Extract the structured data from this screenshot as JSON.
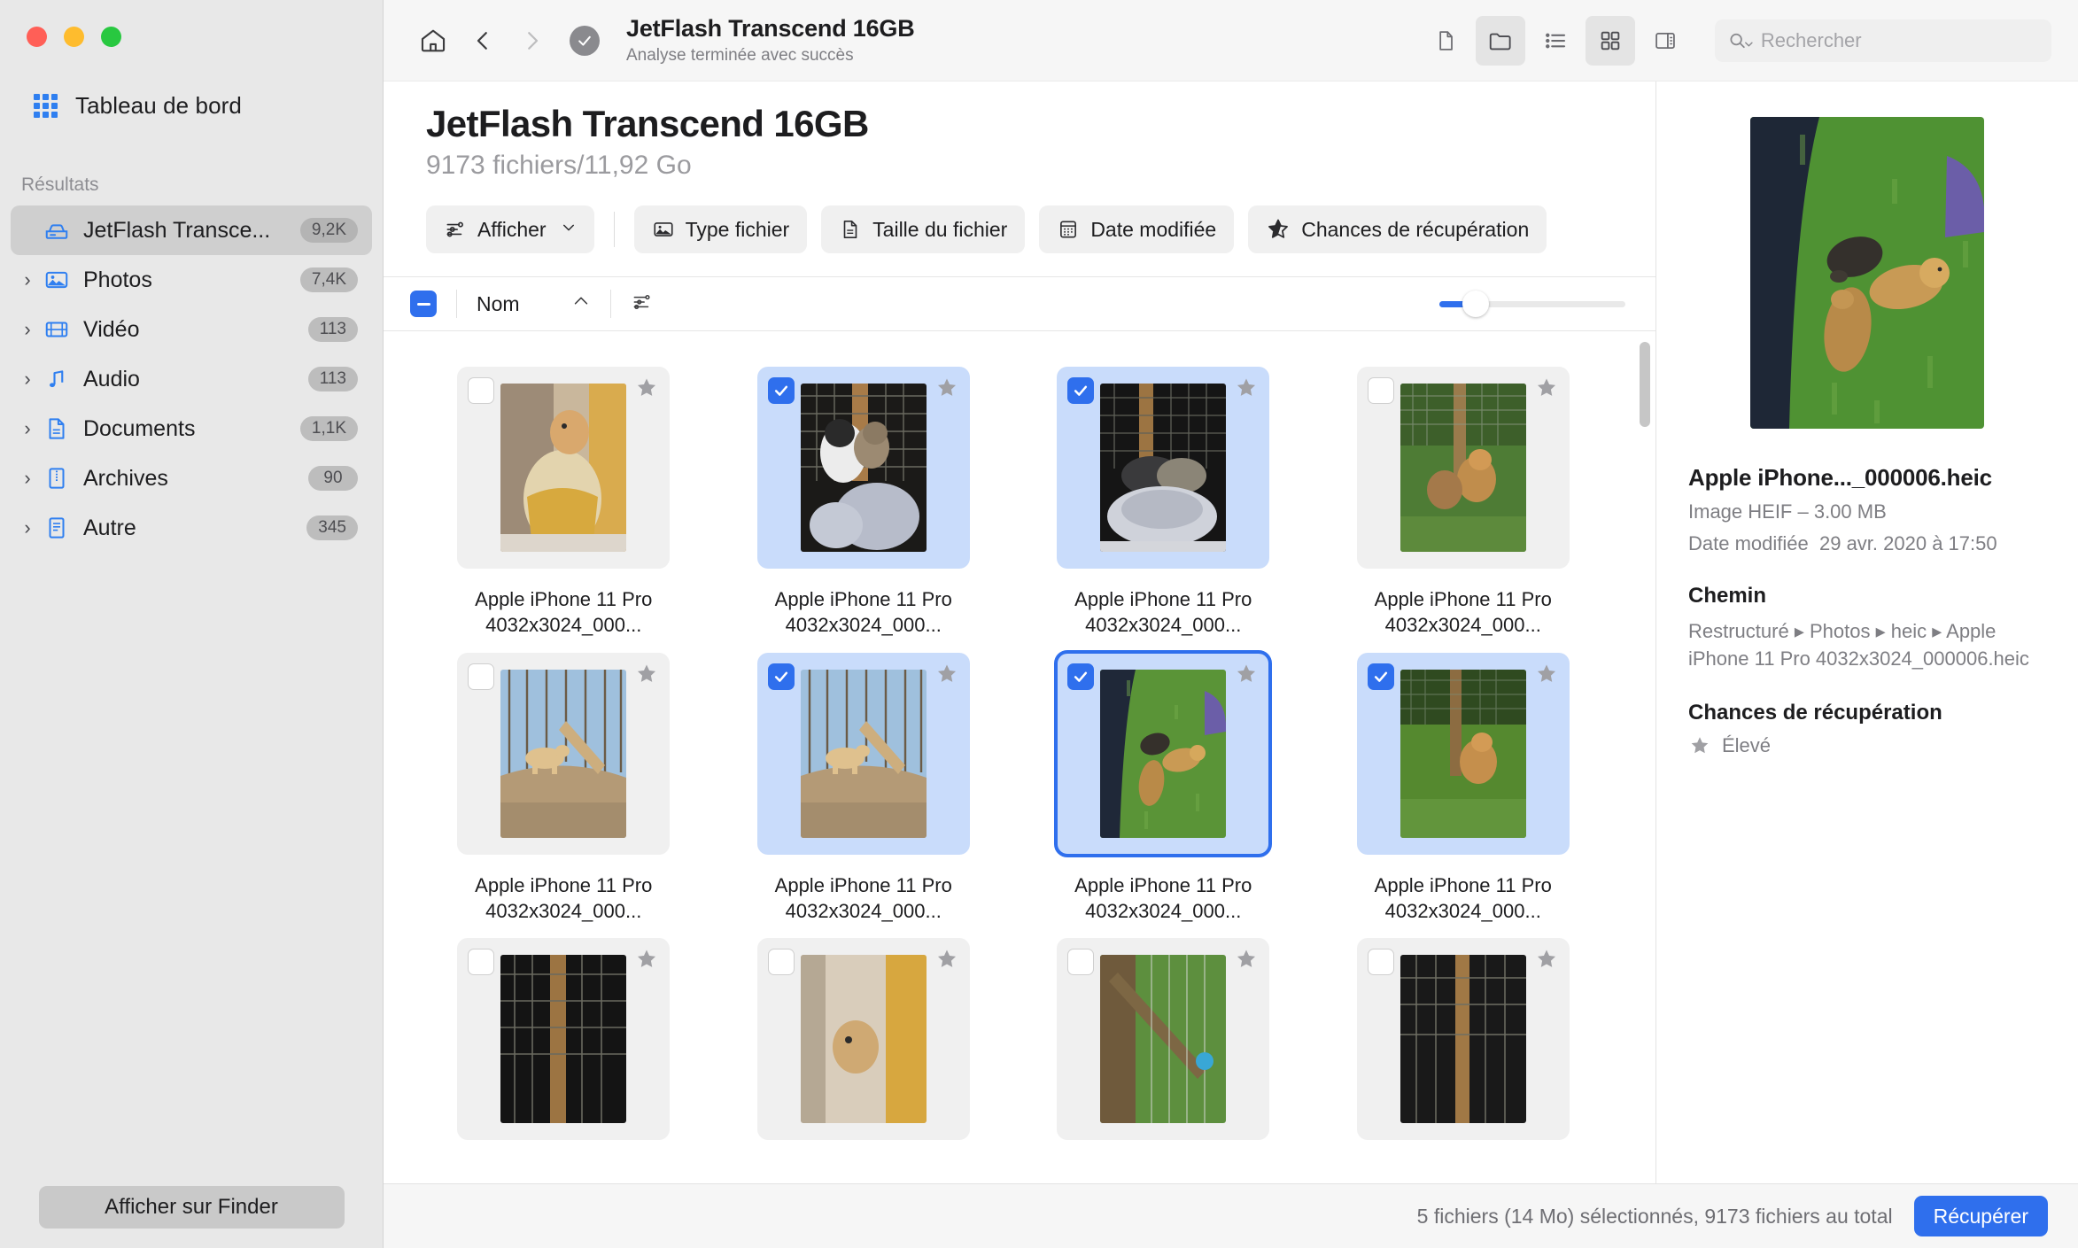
{
  "window": {
    "traffic_lights": [
      "close",
      "minimize",
      "zoom"
    ]
  },
  "sidebar": {
    "dashboard_label": "Tableau de bord",
    "section_title": "Résultats",
    "items": [
      {
        "label": "JetFlash Transce...",
        "badge": "9,2K",
        "icon": "drive-icon",
        "expandable": false,
        "selected": true
      },
      {
        "label": "Photos",
        "badge": "7,4K",
        "icon": "photo-icon",
        "expandable": true,
        "selected": false
      },
      {
        "label": "Vidéo",
        "badge": "113",
        "icon": "video-icon",
        "expandable": true,
        "selected": false
      },
      {
        "label": "Audio",
        "badge": "113",
        "icon": "audio-icon",
        "expandable": true,
        "selected": false
      },
      {
        "label": "Documents",
        "badge": "1,1K",
        "icon": "document-icon",
        "expandable": true,
        "selected": false
      },
      {
        "label": "Archives",
        "badge": "90",
        "icon": "archive-icon",
        "expandable": true,
        "selected": false
      },
      {
        "label": "Autre",
        "badge": "345",
        "icon": "other-icon",
        "expandable": true,
        "selected": false
      }
    ],
    "finder_button": "Afficher sur Finder"
  },
  "toolbar": {
    "home_icon": "home-icon",
    "back_icon": "chevron-left-icon",
    "forward_icon": "chevron-right-icon",
    "status_icon": "checkmark-circle-icon",
    "title": "JetFlash Transcend 16GB",
    "subtitle": "Analyse terminée avec succès",
    "view_buttons": [
      {
        "name": "file-view-icon",
        "active": false
      },
      {
        "name": "folder-view-icon",
        "active": true
      },
      {
        "name": "list-view-icon",
        "active": false
      },
      {
        "name": "grid-view-icon",
        "active": true
      },
      {
        "name": "sidebar-view-icon",
        "active": false
      }
    ],
    "search_placeholder": "Rechercher",
    "search_value": ""
  },
  "page": {
    "title": "JetFlash Transcend 16GB",
    "subtitle": "9173 fichiers/11,92 Go"
  },
  "filters": {
    "show": {
      "label": "Afficher",
      "icon": "sliders-icon",
      "caret": "chevron-down-icon"
    },
    "chips": [
      {
        "label": "Type fichier",
        "icon": "image-icon"
      },
      {
        "label": "Taille du fichier",
        "icon": "document-icon"
      },
      {
        "label": "Date modifiée",
        "icon": "calendar-icon"
      },
      {
        "label": "Chances de récupération",
        "icon": "star-outline-icon"
      }
    ]
  },
  "grid_header": {
    "select_all_state": "partial",
    "sort_column": "Nom",
    "sort_direction_icon": "chevron-up-icon",
    "options_icon": "sliders-icon",
    "zoom_slider_value": 14
  },
  "grid": {
    "items": [
      {
        "caption": "Apple iPhone 11 Pro 4032x3024_000...",
        "checked": false,
        "active": false,
        "starred": true,
        "thumb": "cat-in-basket"
      },
      {
        "caption": "Apple iPhone 11 Pro 4032x3024_000...",
        "checked": true,
        "active": false,
        "starred": true,
        "thumb": "two-cats"
      },
      {
        "caption": "Apple iPhone 11 Pro 4032x3024_000...",
        "checked": true,
        "active": false,
        "starred": true,
        "thumb": "cats-in-bed"
      },
      {
        "caption": "Apple iPhone 11 Pro 4032x3024_000...",
        "checked": false,
        "active": false,
        "starred": true,
        "thumb": "chickens-coop"
      },
      {
        "caption": "Apple iPhone 11 Pro 4032x3024_000...",
        "checked": false,
        "active": false,
        "starred": true,
        "thumb": "dog-on-log"
      },
      {
        "caption": "Apple iPhone 11 Pro 4032x3024_000...",
        "checked": true,
        "active": false,
        "starred": true,
        "thumb": "dog-on-log"
      },
      {
        "caption": "Apple iPhone 11 Pro 4032x3024_000...",
        "checked": true,
        "active": true,
        "starred": true,
        "thumb": "chicks-grass"
      },
      {
        "caption": "Apple iPhone 11 Pro 4032x3024_000...",
        "checked": true,
        "active": false,
        "starred": true,
        "thumb": "chicken-green"
      },
      {
        "caption": "",
        "checked": false,
        "active": false,
        "starred": true,
        "thumb": "dark-coop"
      },
      {
        "caption": "",
        "checked": false,
        "active": false,
        "starred": true,
        "thumb": "cat-door"
      },
      {
        "caption": "",
        "checked": false,
        "active": false,
        "starred": true,
        "thumb": "fence-green"
      },
      {
        "caption": "",
        "checked": false,
        "active": false,
        "starred": true,
        "thumb": "dark-coop2"
      }
    ]
  },
  "breadcrumb": {
    "items": [
      {
        "label": "JetFlash Transcend 16GB",
        "icon": "drive-icon"
      },
      {
        "label": "Restructuré",
        "icon": "folder-badge-icon"
      },
      {
        "label": "Photos",
        "icon": "folder-icon"
      },
      {
        "label": "heic",
        "icon": "folder-icon"
      }
    ],
    "separator": "›"
  },
  "details": {
    "preview_thumb": "chicks-grass",
    "filename": "Apple iPhone..._000006.heic",
    "kind_and_size": "Image HEIF – 3.00 MB",
    "modified_label": "Date modifiée",
    "modified_value": "29 avr. 2020 à 17:50",
    "path_heading": "Chemin",
    "path_value": "Restructuré ▸ Photos ▸ heic ▸ Apple iPhone 11 Pro 4032x3024_000006.heic",
    "recovery_heading": "Chances de récupération",
    "recovery_value": "Élevé",
    "recovery_icon": "star-filled-icon"
  },
  "statusbar": {
    "text": "5 fichiers (14 Mo) sélectionnés, 9173 fichiers au total",
    "recover_button": "Récupérer"
  },
  "colors": {
    "accent": "#2f6fed",
    "sidebar_bg": "#e8e8e8",
    "selection_bg": "#c9dcfb",
    "star": "#a0a0a4",
    "traffic_red": "#ff5f57",
    "traffic_yellow": "#febc2e",
    "traffic_green": "#28c840"
  }
}
